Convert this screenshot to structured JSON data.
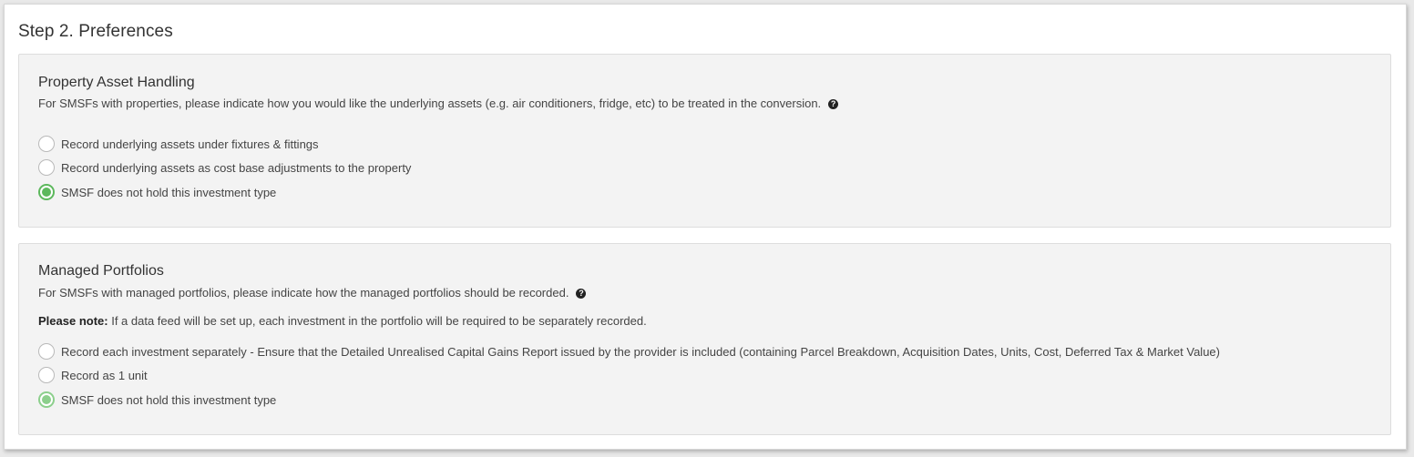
{
  "step_title": "Step 2. Preferences",
  "help_glyph": "?",
  "property": {
    "title": "Property Asset Handling",
    "description": "For SMSFs with properties, please indicate how you would like the underlying assets (e.g. air conditioners, fridge, etc) to be treated in the conversion.",
    "options": [
      {
        "label": "Record underlying assets under fixtures & fittings",
        "selected": false
      },
      {
        "label": "Record underlying assets as cost base adjustments to the property",
        "selected": false
      },
      {
        "label": "SMSF does not hold this investment type",
        "selected": true
      }
    ]
  },
  "managed": {
    "title": "Managed Portfolios",
    "description": "For SMSFs with managed portfolios, please indicate how the managed portfolios should be recorded.",
    "note_label": "Please note:",
    "note_text": " If a data feed will be set up, each investment in the portfolio will be required to be separately recorded.",
    "options": [
      {
        "label": "Record each investment separately - Ensure that the Detailed Unrealised Capital Gains Report issued by the provider is included (containing Parcel Breakdown, Acquisition Dates, Units, Cost, Deferred Tax & Market Value)",
        "selected": false
      },
      {
        "label": "Record as 1 unit",
        "selected": false
      },
      {
        "label": "SMSF does not hold this investment type",
        "selected": true
      }
    ]
  },
  "colors": {
    "selected_radio": "#5cb85c",
    "panel_background": "#f3f3f3"
  }
}
